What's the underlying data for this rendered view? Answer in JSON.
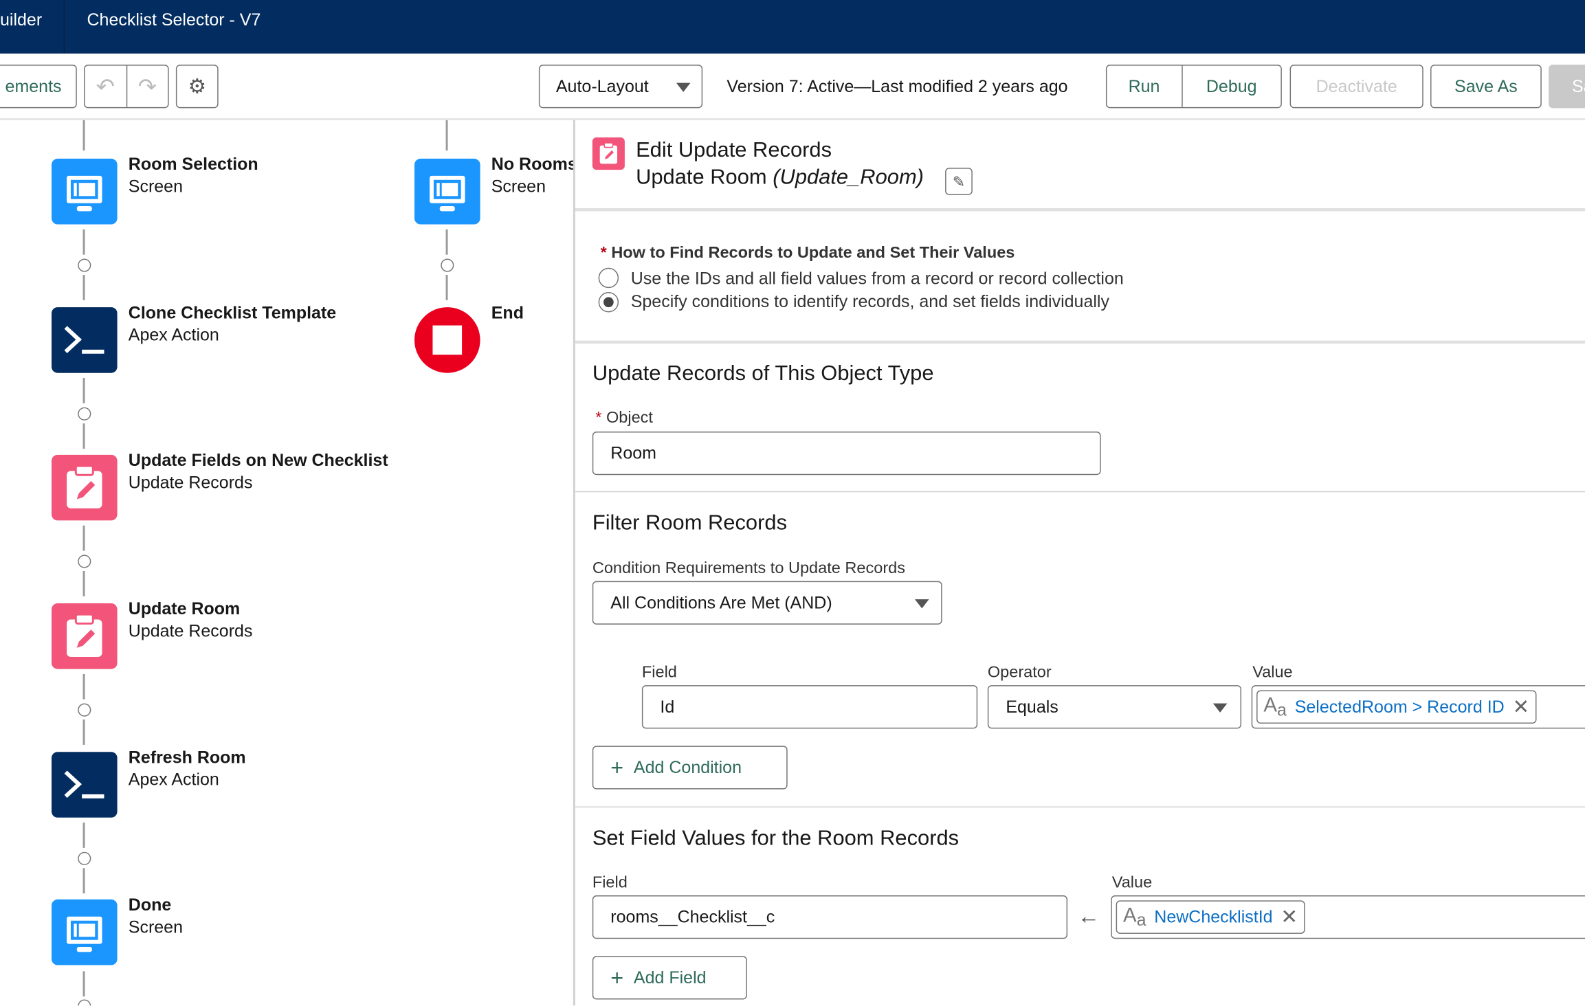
{
  "header": {
    "app_name": "uilder",
    "flow_title": "Checklist Selector - V7"
  },
  "toolbar": {
    "elements_label": "ements",
    "undo_icon": "undo-icon",
    "redo_icon": "redo-icon",
    "settings_icon": "gear-icon",
    "layout_select": "Auto-Layout",
    "version_status": "Version 7: Active—Last modified 2 years ago",
    "run": "Run",
    "debug": "Debug",
    "deactivate": "Deactivate",
    "save_as": "Save As",
    "save": "Sa"
  },
  "canvas": {
    "left_nodes": [
      {
        "title": "Room Selection",
        "type": "Screen",
        "icon": "screen-icon"
      },
      {
        "title": "Clone Checklist Template",
        "type": "Apex Action",
        "icon": "apex-icon"
      },
      {
        "title": "Update Fields on New Checklist",
        "type": "Update Records",
        "icon": "update-records-icon"
      },
      {
        "title": "Update Room",
        "type": "Update Records",
        "icon": "update-records-icon"
      },
      {
        "title": "Refresh Room",
        "type": "Apex Action",
        "icon": "apex-icon"
      },
      {
        "title": "Done",
        "type": "Screen",
        "icon": "screen-icon"
      }
    ],
    "right_nodes": [
      {
        "title": "No Rooms",
        "type": "Screen",
        "icon": "screen-icon"
      },
      {
        "title": "End",
        "icon": "stop-icon"
      }
    ]
  },
  "panel": {
    "title": "Edit Update Records",
    "element_label": "Update Room",
    "element_api": "(Update_Room)",
    "how_to_find": {
      "required": "*",
      "label": "How to Find Records to Update and Set Their Values",
      "options": [
        "Use the IDs and all field values from a record or record collection",
        "Specify conditions to identify records, and set fields individually"
      ],
      "selected_index": 1
    },
    "object_section": {
      "heading": "Update Records of This Object Type",
      "required": "*",
      "object_label": "Object",
      "object_value": "Room"
    },
    "filter_section": {
      "heading": "Filter Room Records",
      "condition_label": "Condition Requirements to Update Records",
      "condition_value": "All Conditions Are Met (AND)",
      "field_header": "Field",
      "operator_header": "Operator",
      "value_header": "Value",
      "conditions": [
        {
          "field": "Id",
          "operator": "Equals",
          "value": "SelectedRoom > Record ID"
        }
      ],
      "add_condition": "Add Condition"
    },
    "set_section": {
      "heading": "Set Field Values for the Room Records",
      "field_header": "Field",
      "value_header": "Value",
      "fields": [
        {
          "field": "rooms__Checklist__c",
          "value": "NewChecklistId"
        }
      ],
      "add_field": "Add Field"
    }
  },
  "colors": {
    "header_bg": "#032d60",
    "screen": "#1b96ff",
    "apex": "#032d60",
    "update": "#f2547a",
    "end": "#ea001e",
    "link": "#0b6fc5",
    "button_text": "#2e6b5a"
  }
}
